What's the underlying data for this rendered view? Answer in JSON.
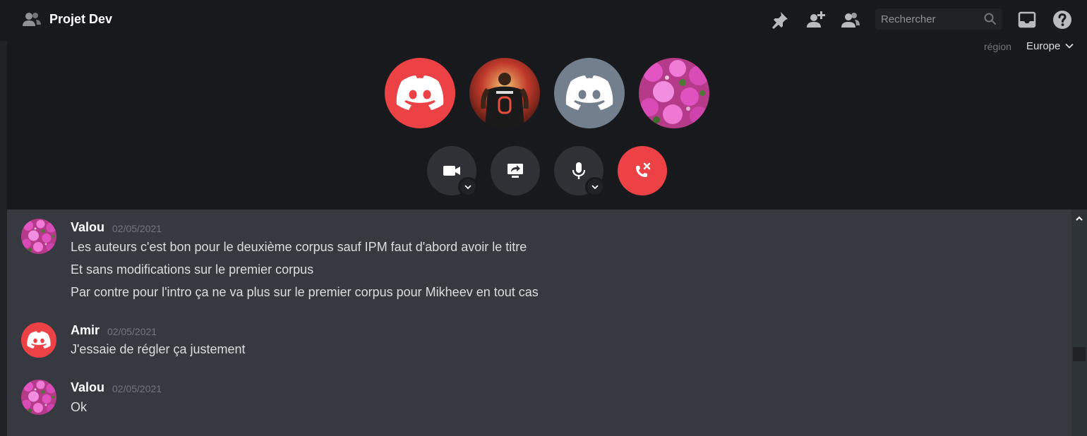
{
  "header": {
    "channel_icon": "voice-group-icon",
    "title": "Projet Dev",
    "tools": [
      "pin-icon",
      "add-member-icon",
      "members-icon"
    ],
    "search_placeholder": "Rechercher",
    "inbox_icon": "inbox-icon",
    "help_icon": "help-icon"
  },
  "region": {
    "label": "région",
    "value": "Europe"
  },
  "participants": [
    {
      "avatar": "discord-logo-red"
    },
    {
      "avatar": "basketball-player-photo"
    },
    {
      "avatar": "discord-logo-grey"
    },
    {
      "avatar": "pink-flowers-photo"
    }
  ],
  "controls": [
    "camera-icon",
    "screen-share-icon",
    "microphone-icon",
    "hang-up-icon"
  ],
  "messages": [
    {
      "author": "Valou",
      "timestamp": "02/05/2021",
      "avatar": "pink-flowers-photo",
      "lines": [
        "Les auteurs c'est bon pour le deuxième corpus sauf IPM faut d'abord avoir le titre",
        "Et sans modifications sur le premier corpus",
        "Par contre pour l'intro ça ne va plus sur le premier corpus pour Mikheev en tout cas"
      ]
    },
    {
      "author": "Amir",
      "timestamp": "02/05/2021",
      "avatar": "discord-logo-red",
      "lines": [
        "J'essaie de régler ça justement"
      ]
    },
    {
      "author": "Valou",
      "timestamp": "02/05/2021",
      "avatar": "pink-flowers-photo",
      "lines": [
        "Ok"
      ]
    }
  ],
  "colors": {
    "accent_red": "#ed4245",
    "grey_avatar": "#747f8d",
    "call_background": "#18191c",
    "chat_background": "#36393f"
  }
}
